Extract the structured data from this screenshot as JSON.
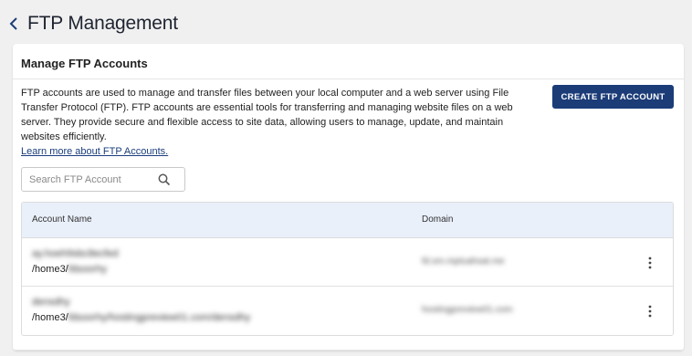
{
  "header": {
    "title": "FTP Management",
    "back_icon": "chevron-left-icon"
  },
  "card": {
    "title": "Manage FTP Accounts",
    "description": "FTP accounts are used to manage and transfer files between your local computer and a web server using File Transfer Protocol (FTP). FTP accounts are essential tools for transferring and managing website files on a web server. They provide secure and flexible access to site data, allowing users to manage, update, and maintain websites efficiently.",
    "learn_more": "Learn more about FTP Accounts.",
    "create_button": "CREATE FTP ACCOUNT",
    "search_placeholder": "Search FTP Account",
    "search_icon": "search-icon"
  },
  "table": {
    "columns": [
      "Account Name",
      "Domain"
    ],
    "rows": [
      {
        "name": "ay.hoeh9sbc8ecfed",
        "path_prefix": "/home3/",
        "path_rest": "fdsoorhy",
        "domain": "fd.sm.mptuahsat.me"
      },
      {
        "name": "densdhy",
        "path_prefix": "/home3/",
        "path_rest": "fdsoorhy/hostingpreview01.com/densdhy",
        "domain": "hostingpreview01.com"
      }
    ],
    "row_action_icon": "more-vertical-icon"
  },
  "colors": {
    "background": "#f0f0f1",
    "primary_button": "#1c3c78",
    "table_header": "#e9f0fa",
    "link": "#1a3d7c"
  }
}
